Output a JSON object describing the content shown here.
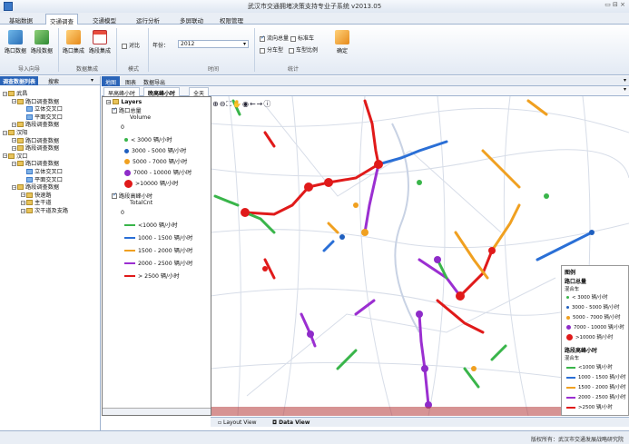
{
  "window": {
    "title": "武汉市交通拥堵决策支持专业子系统 v2013.05",
    "controls": "▭ ⊟ ×"
  },
  "menu": {
    "tabs": [
      "基础数据",
      "交通调查",
      "交通模型",
      "运行分析",
      "多屏联动",
      "权限管理"
    ],
    "active": 1
  },
  "ribbon": {
    "btn_intersection_data": "路口数据",
    "btn_segment_data": "路段数据",
    "btn_intersection_set": "路口集成",
    "btn_segment_set": "路段集成",
    "chk_compare": "对比",
    "year_label": "年份：",
    "year_value": "2012",
    "chk_flow": "流向总量",
    "chk_standard_car": "标准车",
    "chk_split": "分车型",
    "chk_ratio": "车型比例",
    "btn_ok": "确定",
    "group_import": "导入向导",
    "group_integrate": "数据集成",
    "group_mode": "模式",
    "group_time": "时间",
    "group_stats": "统计"
  },
  "left": {
    "tabs": [
      "调查数据列表",
      "搜索"
    ],
    "tree": [
      {
        "label": "武昌",
        "level": 0,
        "type": "folder"
      },
      {
        "label": "路口调查数据",
        "level": 1,
        "type": "folder"
      },
      {
        "label": "立体交叉口",
        "level": 2,
        "type": "leaf"
      },
      {
        "label": "平面交叉口",
        "level": 2,
        "type": "leaf"
      },
      {
        "label": "路段调查数据",
        "level": 1,
        "type": "folder"
      },
      {
        "label": "汉阳",
        "level": 0,
        "type": "folder"
      },
      {
        "label": "路口调查数据",
        "level": 1,
        "type": "folder"
      },
      {
        "label": "路段调查数据",
        "level": 1,
        "type": "folder"
      },
      {
        "label": "汉口",
        "level": 0,
        "type": "folder"
      },
      {
        "label": "路口调查数据",
        "level": 1,
        "type": "folder"
      },
      {
        "label": "立体交叉口",
        "level": 2,
        "type": "leaf"
      },
      {
        "label": "平面交叉口",
        "level": 2,
        "type": "leaf"
      },
      {
        "label": "路段调查数据",
        "level": 1,
        "type": "folder"
      },
      {
        "label": "快速路",
        "level": 2,
        "type": "folder"
      },
      {
        "label": "主干道",
        "level": 2,
        "type": "folder"
      },
      {
        "label": "次干道及支路",
        "level": 2,
        "type": "folder"
      }
    ]
  },
  "maptabs": [
    "地图",
    "图表",
    "数据导出"
  ],
  "doctabs": [
    "早高峰小时",
    "晚高峰小时",
    "全天"
  ],
  "layers": {
    "root": "Layers",
    "intersection_layer": "路口总量",
    "volume_field": "Volume",
    "zero": "0",
    "points": [
      "< 3000 辆/小时",
      "3000 - 5000 辆/小时",
      "5000 - 7000 辆/小时",
      "7000 - 10000 辆/小时",
      ">10000 辆/小时"
    ],
    "segment_layer": "路段高峰小时",
    "total_field": "TotalCnt",
    "lines": [
      "<1000 辆/小时",
      "1000 - 1500 辆/小时",
      "1500 - 2000 辆/小时",
      "2000 - 2500 辆/小时",
      "> 2500 辆/小时"
    ]
  },
  "bottom_tabs": [
    "Layout View",
    "Data View"
  ],
  "legend": {
    "title": "图例",
    "point_title": "路口总量",
    "point_sub": "混合车",
    "points": [
      "< 3000 辆/小时",
      "3000 - 5000 辆/小时",
      "5000 - 7000 辆/小时",
      "7000 - 10000 辆/小时",
      ">10000 辆/小时"
    ],
    "line_title": "路段高峰小时",
    "line_sub": "混合车",
    "lines": [
      "<1000 辆/小时",
      "1000 - 1500 辆/小时",
      "1500 - 2000 辆/小时",
      "2000 - 2500 辆/小时",
      ">2500 辆/小时"
    ]
  },
  "colors": {
    "p1": "#39b54a",
    "p2": "#1f5fbf",
    "p3": "#f0a020",
    "p4": "#8e2cc9",
    "p5": "#e01a1a",
    "l1": "#39b54a",
    "l2": "#2a6fd6",
    "l3": "#f0a020",
    "l4": "#9b2fd1",
    "l5": "#e01a1a"
  },
  "status": "版权所有：武汉市交通发展战略研究院"
}
